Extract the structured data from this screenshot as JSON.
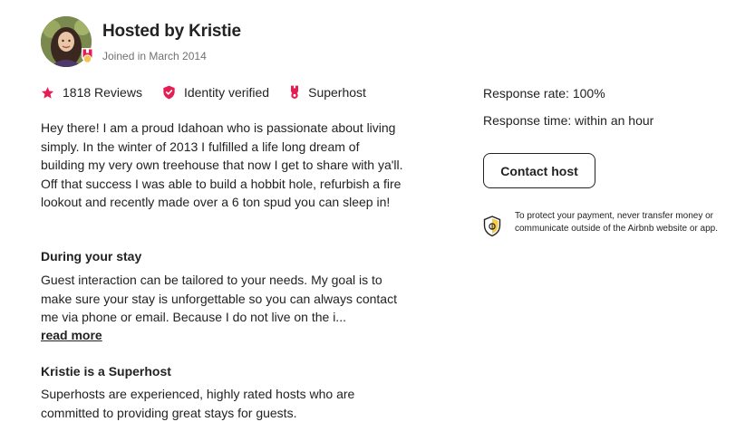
{
  "host": {
    "title": "Hosted by Kristie",
    "joined": "Joined in March 2014"
  },
  "stats": [
    {
      "icon": "star-icon",
      "label": "1818 Reviews"
    },
    {
      "icon": "verified-shield-icon",
      "label": "Identity verified"
    },
    {
      "icon": "superhost-medal-icon",
      "label": "Superhost"
    }
  ],
  "bio": "Hey there! I am a proud Idahoan who is passionate about living simply. In the winter of 2013 I fulfilled a life long dream of building my very own treehouse that now I get to share with ya'll. Off that success I was able to build a hobbit hole, refurbish a fire lookout and recently made over a 6 ton spud you can sleep in!",
  "during_stay": {
    "heading": "During your stay",
    "text": "Guest interaction can be tailored to your needs. My goal is to make sure your stay is unforgettable so you can always contact me via phone or email. Because I do not live on the i...",
    "read_more": "read more"
  },
  "superhost_section": {
    "heading": "Kristie is a Superhost",
    "text": "Superhosts are experienced, highly rated hosts who are committed to providing great stays for guests."
  },
  "response": {
    "rate": "Response rate: 100%",
    "time": "Response time: within an hour"
  },
  "contact_button": "Contact host",
  "protection_notice": "To protect your payment, never transfer money or communicate outside of the Airbnb website or app.",
  "colors": {
    "brand": "#E51D53",
    "text": "#222222",
    "muted": "#717171"
  }
}
